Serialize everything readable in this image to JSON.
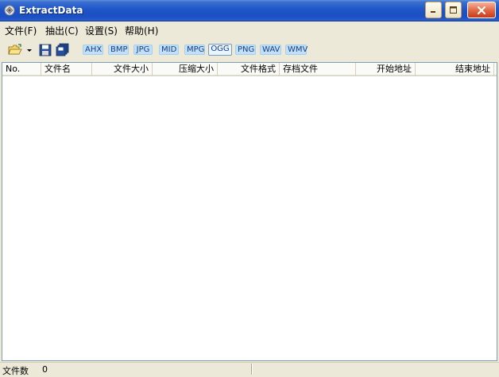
{
  "window": {
    "title": "ExtractData"
  },
  "menu": {
    "items": [
      {
        "label": "文件(F)"
      },
      {
        "label": "抽出(C)"
      },
      {
        "label": "设置(S)"
      },
      {
        "label": "帮助(H)"
      }
    ]
  },
  "toolbar": {
    "icons": [
      "open-folder-icon",
      "dropdown-arrow-icon",
      "save-icon",
      "save-all-icon"
    ],
    "formats": [
      "AHX",
      "BMP",
      "JPG",
      "MID",
      "MPG",
      "OGG",
      "PNG",
      "WAV",
      "WMV"
    ],
    "active_format": "OGG"
  },
  "list": {
    "columns": [
      "No.",
      "文件名",
      "文件大小",
      "压缩大小",
      "文件格式",
      "存档文件",
      "开始地址",
      "结束地址"
    ],
    "rows": []
  },
  "status": {
    "label": "文件数",
    "count": "0"
  },
  "colors": {
    "titlebar": "#1f55c8",
    "format_button_bg": "#bfe0f6",
    "format_button_text": "#1a3d8a",
    "window_bg": "#ece9d8"
  }
}
